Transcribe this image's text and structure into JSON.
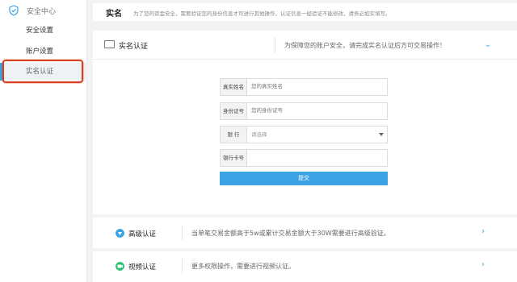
{
  "sidebar": {
    "title": "安全中心",
    "items": [
      {
        "label": "安全设置"
      },
      {
        "label": "账户设置"
      },
      {
        "label": "实名认证"
      }
    ]
  },
  "topbar": {
    "title": "实名",
    "note": "为了您的资金安全，需要验证您的身份信息才可进行其他操作，认证信息一经验证不能修改，请务必如实填写。"
  },
  "realname_panel": {
    "title": "实名认证",
    "desc": "为保障您的账户安全，请完成实名认证后方可交易操作！"
  },
  "form": {
    "fields": [
      {
        "label": "真实姓名",
        "placeholder": "您的真实姓名"
      },
      {
        "label": "身份证号",
        "placeholder": "您的身份证号"
      },
      {
        "label": "银 行",
        "placeholder": "请选择"
      },
      {
        "label": "银行卡号",
        "placeholder": ""
      }
    ],
    "submit": "提交"
  },
  "advanced_panel": {
    "title": "高级认证",
    "desc": "当单笔交易金额高于5w或累计交易金额大于30W需要进行高级验证。"
  },
  "video_panel": {
    "title": "视频认证",
    "desc": "更多权限操作，需要进行视频认证。"
  },
  "colors": {
    "accent": "#3aa3e3",
    "highlight_border": "#d9401f",
    "green_icon": "#2fbf71"
  },
  "icons": {
    "sidebar": "shield-icon",
    "realname": "id-card-icon",
    "advanced": "advanced-badge-icon",
    "video": "video-badge-icon",
    "expand": "chevron-down-icon",
    "enter": "chevron-right-icon"
  }
}
